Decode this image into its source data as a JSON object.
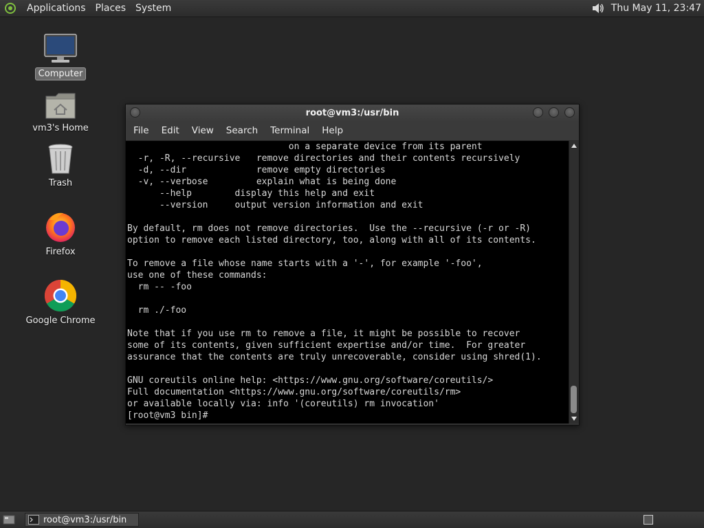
{
  "top_panel": {
    "menus": [
      "Applications",
      "Places",
      "System"
    ],
    "clock": "Thu May 11, 23:47",
    "icons": {
      "logo": "distro-logo-icon",
      "volume": "volume-icon"
    }
  },
  "desktop": {
    "icons": [
      {
        "label": "Computer",
        "icon": "computer-icon"
      },
      {
        "label": "vm3's Home",
        "icon": "home-folder-icon"
      },
      {
        "label": "Trash",
        "icon": "trash-icon"
      },
      {
        "label": "Firefox",
        "icon": "firefox-icon"
      },
      {
        "label": "Google Chrome",
        "icon": "chrome-icon"
      }
    ]
  },
  "terminal": {
    "title": "root@vm3:/usr/bin",
    "menus": [
      "File",
      "Edit",
      "View",
      "Search",
      "Terminal",
      "Help"
    ],
    "lines": [
      "                              on a separate device from its parent",
      "  -r, -R, --recursive   remove directories and their contents recursively",
      "  -d, --dir             remove empty directories",
      "  -v, --verbose         explain what is being done",
      "      --help        display this help and exit",
      "      --version     output version information and exit",
      "",
      "By default, rm does not remove directories.  Use the --recursive (-r or -R)",
      "option to remove each listed directory, too, along with all of its contents.",
      "",
      "To remove a file whose name starts with a '-', for example '-foo',",
      "use one of these commands:",
      "  rm -- -foo",
      "",
      "  rm ./-foo",
      "",
      "Note that if you use rm to remove a file, it might be possible to recover",
      "some of its contents, given sufficient expertise and/or time.  For greater",
      "assurance that the contents are truly unrecoverable, consider using shred(1).",
      "",
      "GNU coreutils online help: <https://www.gnu.org/software/coreutils/>",
      "Full documentation <https://www.gnu.org/software/coreutils/rm>",
      "or available locally via: info '(coreutils) rm invocation'",
      "[root@vm3 bin]# "
    ]
  },
  "bottom_panel": {
    "task_label": "root@vm3:/usr/bin"
  }
}
